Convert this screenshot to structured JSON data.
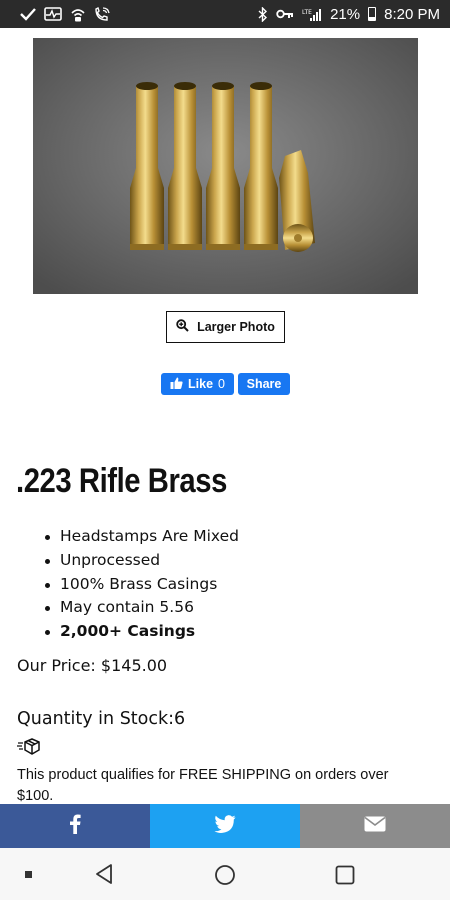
{
  "status_bar": {
    "battery_percent": "21%",
    "time": "8:20 PM",
    "left_icons": [
      "check-icon",
      "pulse-icon",
      "wifi-call-icon",
      "phone-wifi-icon"
    ],
    "right_icons": [
      "bluetooth-icon",
      "key-icon",
      "signal-icon",
      "battery-icon"
    ]
  },
  "product": {
    "larger_photo_label": "Larger Photo",
    "title": ".223 Rifle Brass",
    "features": [
      "Headstamps Are Mixed",
      "Unprocessed",
      "100% Brass Casings",
      "May contain 5.56",
      "2,000+ Casings"
    ],
    "price_text": "Our Price: $145.00",
    "stock_text": "Quantity in Stock:6",
    "shipping_note": "This product qualifies for FREE SHIPPING on orders over $100."
  },
  "social": {
    "like_label": "Like",
    "like_count": "0",
    "share_label": "Share"
  },
  "share_bar": {
    "buttons": [
      "facebook-icon",
      "twitter-icon",
      "email-icon"
    ],
    "colors": {
      "facebook": "#3b5998",
      "twitter": "#1da1f2",
      "email": "#8c8c8c"
    }
  },
  "nav_bar": {
    "buttons": [
      "recent-dot",
      "back-icon",
      "home-icon",
      "overview-icon"
    ]
  }
}
